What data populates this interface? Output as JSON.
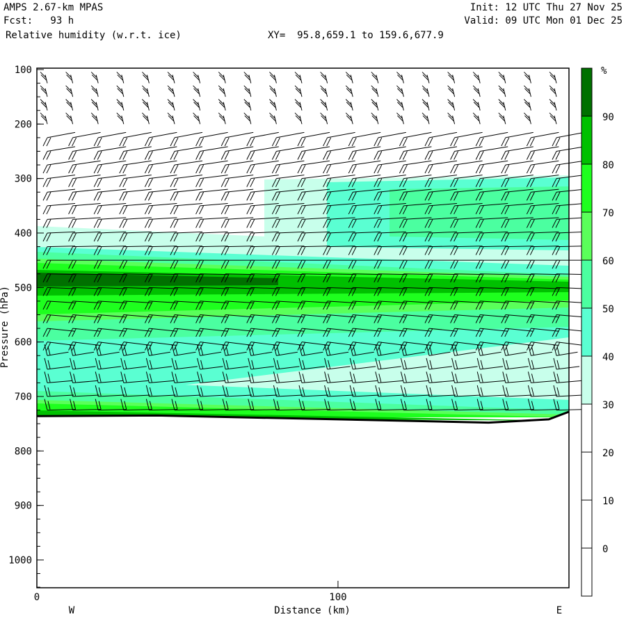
{
  "header": {
    "model": "AMPS 2.67-km MPAS",
    "forecast": "Fcst:   93 h",
    "field": "Relative humidity (w.r.t. ice)",
    "xy": "XY=  95.8,659.1 to 159.6,677.9",
    "init": "Init: 12 UTC Thu 27 Nov 25",
    "valid": "Valid: 09 UTC Mon 01 Dec 25"
  },
  "chart_data": {
    "type": "heatmap",
    "title": "Relative humidity (w.r.t. ice)",
    "xlabel": "Distance (km)",
    "ylabel": "Pressure (hPa)",
    "xlim": [
      0,
      176.7
    ],
    "ylim": [
      1050,
      100
    ],
    "xticks": [
      "0",
      "100"
    ],
    "xtick_values": [
      0,
      100
    ],
    "x_end_labels": {
      "left": "W",
      "right": "E"
    },
    "yticks": [
      "100",
      "200",
      "300",
      "400",
      "500",
      "600",
      "700",
      "800",
      "900",
      "1000"
    ],
    "ytick_values": [
      100,
      200,
      300,
      400,
      500,
      600,
      700,
      800,
      900,
      1000
    ],
    "colorbar": {
      "unit": "%",
      "labels": [
        "90",
        "80",
        "70",
        "60",
        "50",
        "40",
        "30",
        "20",
        "10",
        "0"
      ],
      "levels": [
        -10,
        0,
        10,
        20,
        30,
        40,
        50,
        60,
        70,
        80,
        90,
        100
      ],
      "colors": [
        "#ffffff",
        "#ffffff",
        "#ffffff",
        "#ffffff",
        "#c8ffeb",
        "#5affd2",
        "#4bffa0",
        "#5aff5a",
        "#1eff1e",
        "#00c000",
        "#007000"
      ]
    },
    "overlay": "wind barbs",
    "terrain_surface_hPa": {
      "x": [
        0,
        40,
        100,
        150,
        170,
        176.7
      ],
      "p": [
        736,
        735,
        742,
        748,
        742,
        728
      ]
    }
  }
}
